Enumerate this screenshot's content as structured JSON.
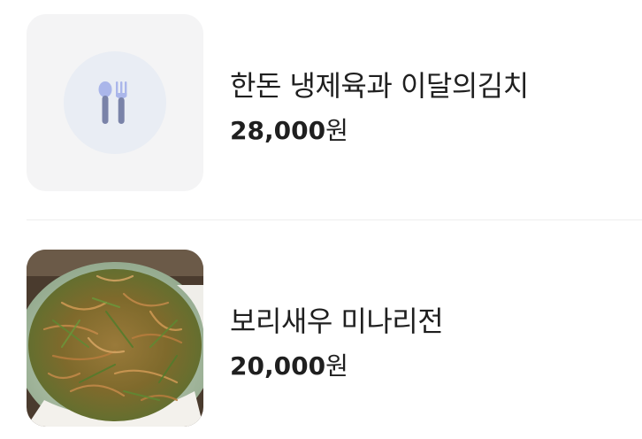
{
  "menu": {
    "items": [
      {
        "name": "한돈 냉제육과 이달의김치",
        "price": "28,000",
        "currency": "원",
        "image": "placeholder-utensils-icon"
      },
      {
        "name": "보리새우 미나리전",
        "price": "20,000",
        "currency": "원",
        "image": "pancake-photo"
      }
    ]
  },
  "colors": {
    "placeholder_bg": "#f4f4f5",
    "placeholder_circle": "#e9edf4",
    "icon_blue": "#aab6ea",
    "icon_slate": "#7a83a8",
    "text": "#1f1f1f",
    "divider": "#eeeeee"
  }
}
